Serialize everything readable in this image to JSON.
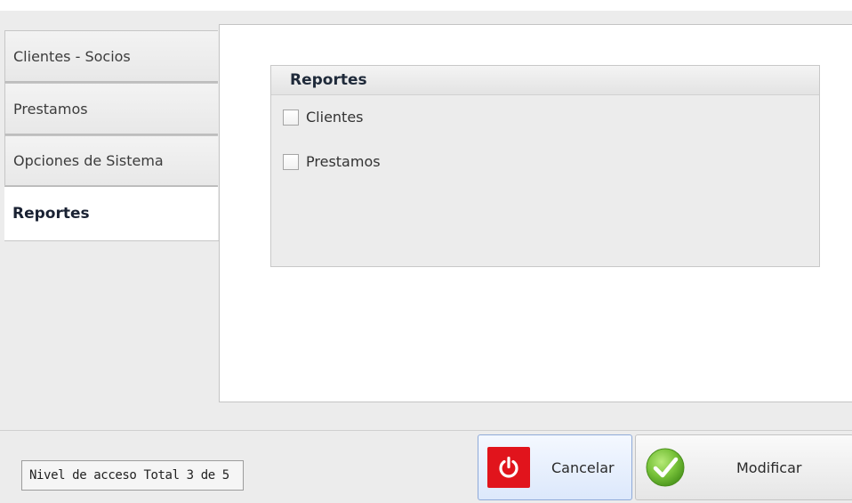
{
  "tabs": [
    {
      "label": "Clientes - Socios"
    },
    {
      "label": "Prestamos"
    },
    {
      "label": "Opciones de Sistema"
    },
    {
      "label": "Reportes",
      "active": true
    }
  ],
  "group": {
    "title": "Reportes",
    "checkboxes": [
      {
        "label": "Clientes",
        "checked": false
      },
      {
        "label": "Prestamos",
        "checked": false
      }
    ]
  },
  "status": {
    "text": "Nivel de acceso Total 3 de 5"
  },
  "buttons": {
    "cancel": {
      "label": "Cancelar",
      "icon": "power-icon",
      "icon_color": "#e1141c"
    },
    "modify": {
      "label": "Modificar",
      "icon": "checkmark-icon",
      "icon_color": "#6fbf2f"
    }
  }
}
